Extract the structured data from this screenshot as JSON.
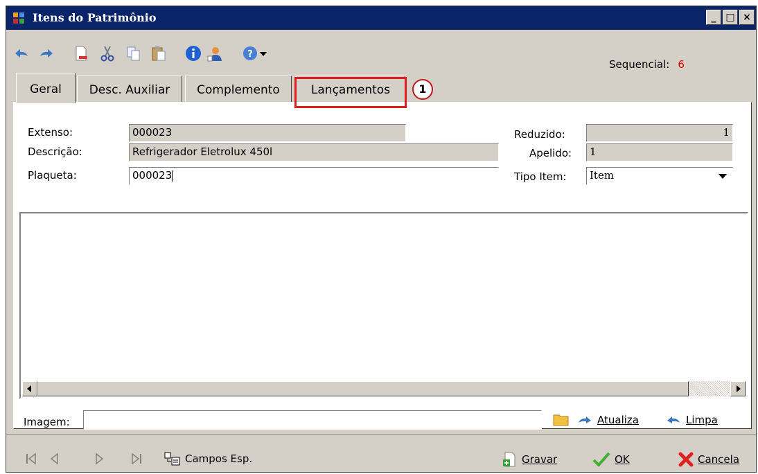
{
  "window": {
    "title": "Itens do Patrimônio",
    "controls": [
      "_",
      "□",
      "×"
    ]
  },
  "toolbar": {
    "icons": [
      "undo-icon",
      "redo-icon",
      "new-document-icon",
      "cut-icon",
      "copy-icon",
      "paste-icon",
      "info-icon",
      "user-icon",
      "help-icon",
      "dropdown-arrow-icon"
    ]
  },
  "sequencial": {
    "label": "Sequencial:",
    "value": "6"
  },
  "tabs": [
    {
      "label": "Geral",
      "active": true
    },
    {
      "label": "Desc. Auxiliar",
      "active": false
    },
    {
      "label": "Complemento",
      "active": false
    },
    {
      "label": "Lançamentos",
      "active": false
    }
  ],
  "callout": {
    "number": "1"
  },
  "form": {
    "extenso": {
      "label": "Extenso:",
      "value": "000023"
    },
    "descricao": {
      "label": "Descrição:",
      "value": "Refrigerador Eletrolux 450l"
    },
    "plaqueta": {
      "label": "Plaqueta:",
      "value": "000023"
    },
    "reduzido": {
      "label": "Reduzido:",
      "value": "1"
    },
    "apelido": {
      "label": "Apelido:",
      "value": "1"
    },
    "tipo_item": {
      "label": "Tipo Item:",
      "value": "Item"
    }
  },
  "imagem": {
    "label": "Imagem:",
    "value": "",
    "atualiza": "Atualiza",
    "limpa": "Limpa"
  },
  "footer": {
    "campos_esp": "Campos Esp.",
    "gravar": "Gravar",
    "ok": "OK",
    "cancela": "Cancela"
  },
  "colors": {
    "titlebar": "#0a246a",
    "highlight": "#e01b1b",
    "window_bg": "#d4d0c8",
    "sequencial_value": "#e00000"
  }
}
